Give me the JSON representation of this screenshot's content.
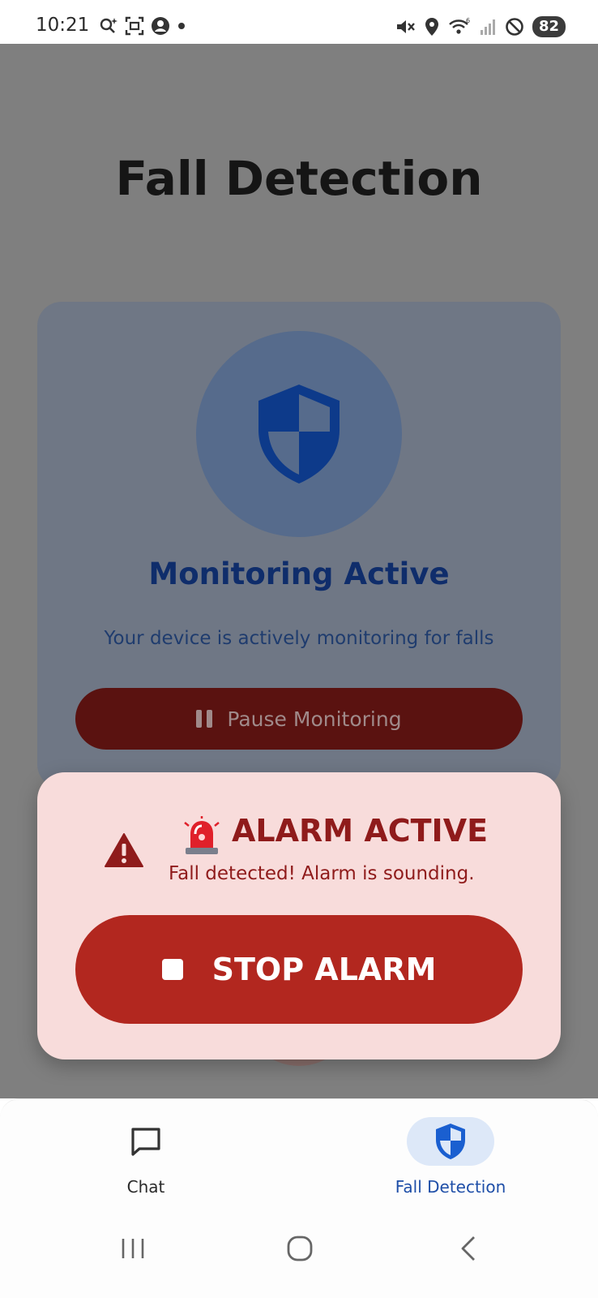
{
  "status_bar": {
    "time": "10:21",
    "battery": "82",
    "left_icons": [
      "assistant-sparkle-icon",
      "screenshot-icon",
      "account-icon",
      "dot-icon"
    ],
    "right_icons": [
      "vibrate-mute-icon",
      "location-icon",
      "wifi-icon",
      "signal-icon",
      "do-not-disturb-icon"
    ]
  },
  "page": {
    "title": "Fall Detection"
  },
  "monitoring_card": {
    "icon": "shield-icon",
    "title": "Monitoring Active",
    "description": "Your device is actively monitoring for falls",
    "pause_button_label": "Pause Monitoring"
  },
  "alarm": {
    "title": "ALARM ACTIVE",
    "message": "Fall detected! Alarm is sounding.",
    "stop_button_label": "STOP ALARM",
    "icons": [
      "warning-icon",
      "siren-icon",
      "stop-icon"
    ]
  },
  "bottom_nav": {
    "items": [
      {
        "label": "Chat",
        "icon": "chat-icon",
        "selected": false
      },
      {
        "label": "Fall Detection",
        "icon": "shield-icon",
        "selected": true
      }
    ]
  },
  "system_nav": [
    "recents-icon",
    "home-icon",
    "back-icon"
  ],
  "colors": {
    "primary_blue": "#0d3a8a",
    "alarm_red": "#b2271f",
    "alarm_bg": "#f8dcdb",
    "nav_selected_bg": "#dde8f8"
  }
}
